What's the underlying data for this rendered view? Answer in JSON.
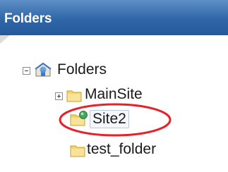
{
  "header": {
    "title": "Folders"
  },
  "tree": {
    "root": {
      "label": "Folders",
      "icon": "home-folder-icon",
      "expanded": true
    },
    "children": [
      {
        "label": "MainSite",
        "icon": "folder-icon",
        "expander": "plus"
      },
      {
        "label": "Site2",
        "icon": "site-folder-icon",
        "selected": true
      },
      {
        "label": "test_folder",
        "icon": "folder-icon"
      }
    ]
  },
  "colors": {
    "header_bg": "#2f66a8",
    "highlight": "#e8202a",
    "folder": "#f5d76e"
  }
}
